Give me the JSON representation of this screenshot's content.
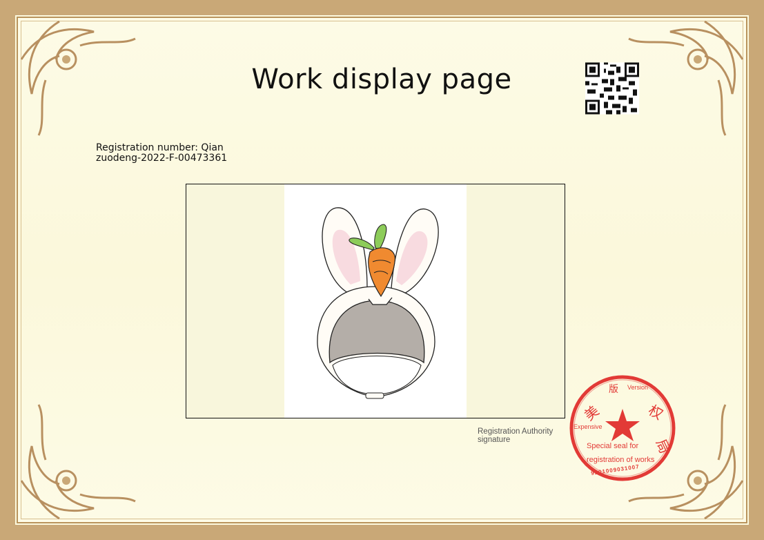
{
  "certificate": {
    "title": "Work display page",
    "registration_line1": "Registration number: Qian",
    "registration_line2": "zuodeng-2022-F-00473361",
    "authority_line1": "Registration Authority",
    "authority_line2": "signature"
  },
  "seal": {
    "top_word": "Version",
    "left_word": "Expensive",
    "line1": "Special seal for",
    "line2": "registration of works",
    "serial": "9201009031007",
    "color": "#e23a36"
  },
  "colors": {
    "frame": "#c9a877",
    "background": "#fcfadf"
  },
  "icons": [
    "qr-code-icon",
    "corner-ornament-icon",
    "seal-star-icon"
  ]
}
